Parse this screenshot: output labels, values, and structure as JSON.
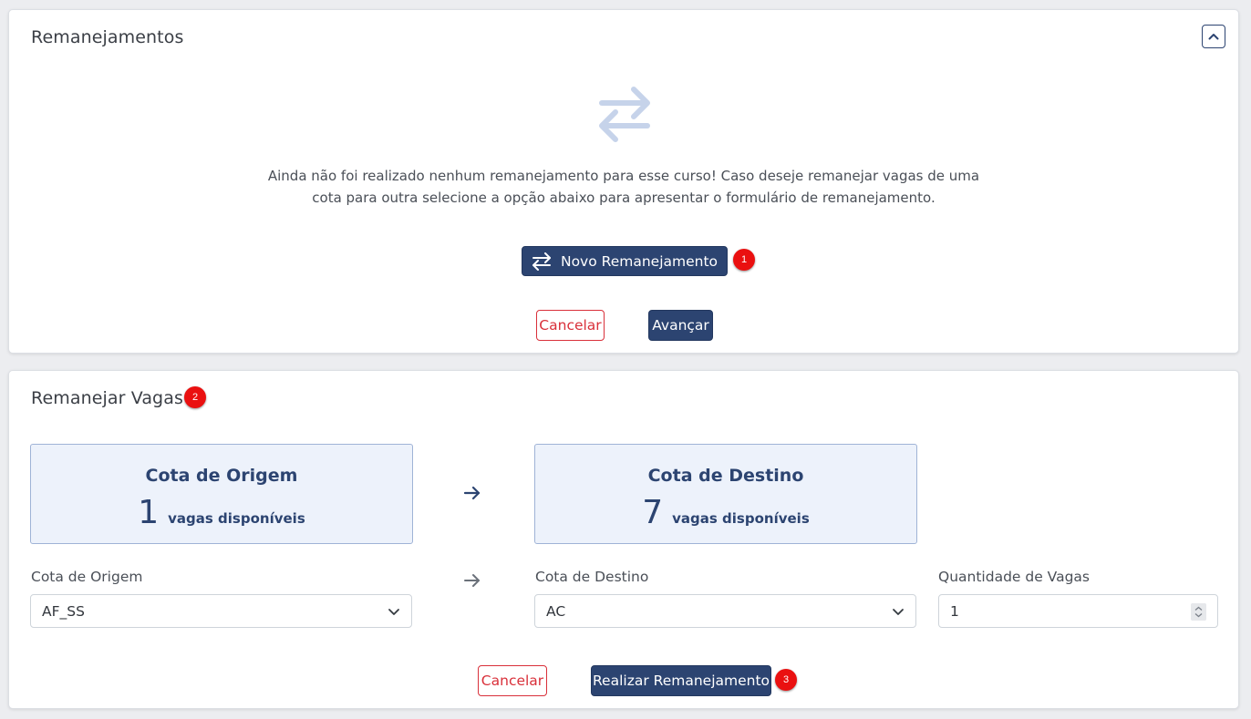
{
  "remanejamentos": {
    "title": "Remanejamentos",
    "empty_message": "Ainda não foi realizado nenhum remanejamento para esse curso! Caso deseje remanejar vagas de uma cota para outra selecione a opção abaixo para apresentar o formulário de remanejamento.",
    "novo_button": "Novo Remanejamento",
    "cancel_button": "Cancelar",
    "advance_button": "Avançar",
    "collapse_icon": "chevron-up-icon",
    "empty_icon": "swap-arrows-icon"
  },
  "remanejar": {
    "title": "Remanejar Vagas",
    "origem_box": {
      "title": "Cota de Origem",
      "count": "1",
      "sub": "vagas disponíveis"
    },
    "destino_box": {
      "title": "Cota de Destino",
      "count": "7",
      "sub": "vagas disponíveis"
    },
    "fields": {
      "origem_label": "Cota de Origem",
      "origem_value": "AF_SS",
      "destino_label": "Cota de Destino",
      "destino_value": "AC",
      "quantidade_label": "Quantidade de Vagas",
      "quantidade_value": "1"
    },
    "cancel_button": "Cancelar",
    "submit_button": "Realizar Remanejamento"
  },
  "badges": [
    "1",
    "2",
    "3"
  ],
  "colors": {
    "primary": "#2c4471",
    "danger": "#d9303a",
    "badge": "#ea1010",
    "box_bg": "#edf2fb",
    "page_bg": "#ecedf0"
  }
}
